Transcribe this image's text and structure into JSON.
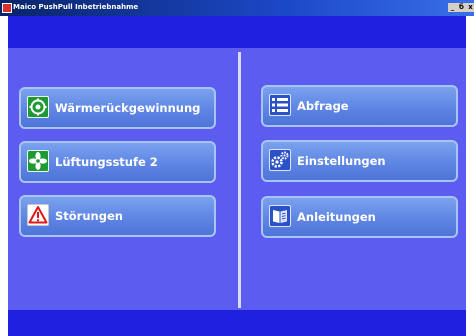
{
  "window": {
    "title": "Maico PushPull Inbetriebnahme",
    "controls": {
      "minimize": "_",
      "maximize": "б",
      "close": "x"
    }
  },
  "colors": {
    "titlebar": "#0a246a",
    "header_band": "#2020e0",
    "panel": "#5c5cf0",
    "button": "#5f86e4",
    "divider": "#d8dcf8"
  },
  "menu": {
    "left": [
      {
        "label": "Wärmerückgewinnung",
        "icon": "heat-recovery-icon"
      },
      {
        "label": "Lüftungsstufe 2",
        "icon": "fan-icon"
      },
      {
        "label": "Störungen",
        "icon": "warning-icon"
      }
    ],
    "right": [
      {
        "label": "Abfrage",
        "icon": "list-icon"
      },
      {
        "label": "Einstellungen",
        "icon": "gears-icon"
      },
      {
        "label": "Anleitungen",
        "icon": "manual-icon"
      }
    ]
  }
}
